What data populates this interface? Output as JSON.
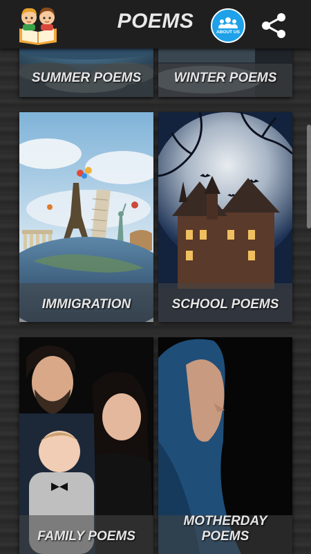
{
  "header": {
    "title": "POEMS",
    "about_label": "ABOUT US",
    "logo_icon": "children-reading-book-icon",
    "share_icon": "share-icon"
  },
  "categories": [
    {
      "label": "SUMMER POEMS"
    },
    {
      "label": "WINTER POEMS"
    },
    {
      "label": "IMMIGRATION"
    },
    {
      "label": "SCHOOL POEMS"
    },
    {
      "label": "FAMILY POEMS"
    },
    {
      "label": "MOTHERDAY POEMS"
    }
  ],
  "colors": {
    "appbar": "#1f1f1f",
    "about_button": "#1ea1e8",
    "caption_text": "#e6e6e6"
  }
}
